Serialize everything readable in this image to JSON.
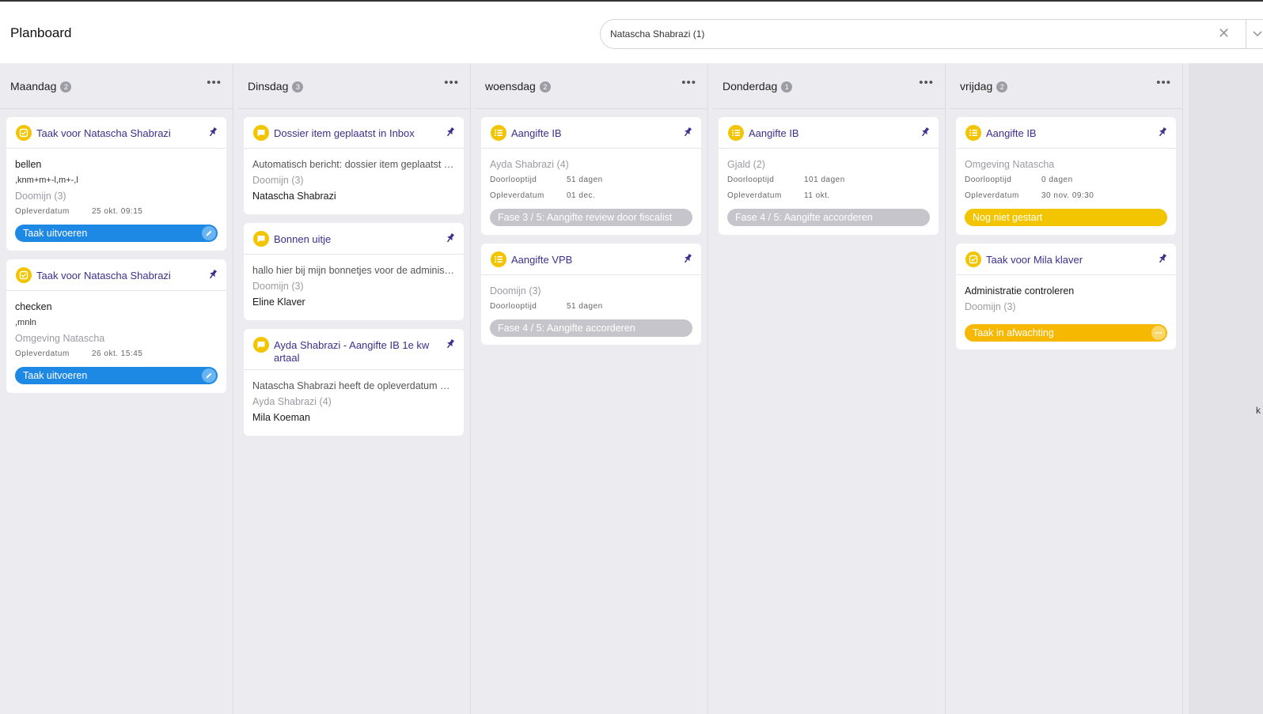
{
  "header": {
    "title": "Planboard",
    "search_value": "Natascha Shabrazi (1)"
  },
  "columns": [
    {
      "name": "Maandag",
      "count": "2",
      "cards": [
        {
          "icon": "task-icon",
          "title": "Taak voor Natascha Shabrazi",
          "lines": [
            "bellen",
            ",knm+m+-l,m+-,l"
          ],
          "client": "Doomijn (3)",
          "meta_label": "Opleverdatum",
          "meta_value": "25 okt. 09:15",
          "action": "Taak uitvoeren"
        },
        {
          "icon": "task-icon",
          "title": "Taak voor Natascha Shabrazi",
          "lines": [
            "checken",
            ",mnln"
          ],
          "client": "Omgeving Natascha",
          "meta_label": "Opleverdatum",
          "meta_value": "26 okt. 15:45",
          "action": "Taak uitvoeren"
        }
      ]
    },
    {
      "name": "Dinsdag",
      "count": "3",
      "cards": [
        {
          "icon": "message-icon",
          "title": "Dossier item geplaatst in Inbox",
          "text": "Automatisch bericht: dossier item geplaatst in Inbox",
          "client": "Doomijn (3)",
          "person": "Natascha Shabrazi"
        },
        {
          "icon": "message-icon",
          "title": "Bonnen uitje",
          "text": "hallo hier bij mijn bonnetjes voor de administratie",
          "client": "Doomijn (3)",
          "person": "Eline Klaver"
        },
        {
          "icon": "message-icon",
          "title": "Ayda Shabrazi - Aangifte IB 1e kw artaal",
          "text": "Natascha Shabrazi heeft de opleverdatum gewijzigd",
          "client": "Ayda Shabrazi (4)",
          "person": "Mila Koeman"
        }
      ]
    },
    {
      "name": "woensdag",
      "count": "2",
      "cards": [
        {
          "icon": "list-icon",
          "title": "Aangifte IB",
          "client": "Ayda Shabrazi (4)",
          "meta": [
            {
              "label": "Doorlooptijd",
              "value": "51 dagen"
            },
            {
              "label": "Opleverdatum",
              "value": "01 dec."
            }
          ],
          "phase": "Fase 3 / 5: Aangifte review door fiscalist"
        },
        {
          "icon": "list-icon",
          "title": "Aangifte VPB",
          "client": "Doomijn (3)",
          "meta": [
            {
              "label": "Doorlooptijd",
              "value": "51 dagen"
            }
          ],
          "phase": "Fase 4 / 5: Aangifte accorderen"
        }
      ]
    },
    {
      "name": "Donderdag",
      "count": "1",
      "cards": [
        {
          "icon": "list-icon",
          "title": "Aangifte IB",
          "client": "Gjald (2)",
          "meta": [
            {
              "label": "Doorlooptijd",
              "value": "101 dagen"
            },
            {
              "label": "Opleverdatum",
              "value": "11 okt."
            }
          ],
          "phase": "Fase 4 / 5: Aangifte accorderen"
        }
      ]
    },
    {
      "name": "vrijdag",
      "count": "2",
      "cards": [
        {
          "icon": "list-icon",
          "title": "Aangifte IB",
          "client": "Omgeving Natascha",
          "meta": [
            {
              "label": "Doorlooptijd",
              "value": "0 dagen"
            },
            {
              "label": "Opleverdatum",
              "value": "30 nov. 09:30"
            }
          ],
          "phase": "Nog niet gestart"
        },
        {
          "icon": "task-icon",
          "title": "Taak voor Mila klaver",
          "text": "Administratie controleren",
          "client": "Doomijn (3)",
          "action": "Taak in afwachting"
        }
      ]
    }
  ],
  "right_peek": "k",
  "colors": {
    "accent_purple": "#3d2f8c",
    "icon_yellow": "#f2c500",
    "action_blue": "#1e88e5",
    "phase_gray": "#c5c5cb",
    "waiting_amber": "#f6b800"
  }
}
